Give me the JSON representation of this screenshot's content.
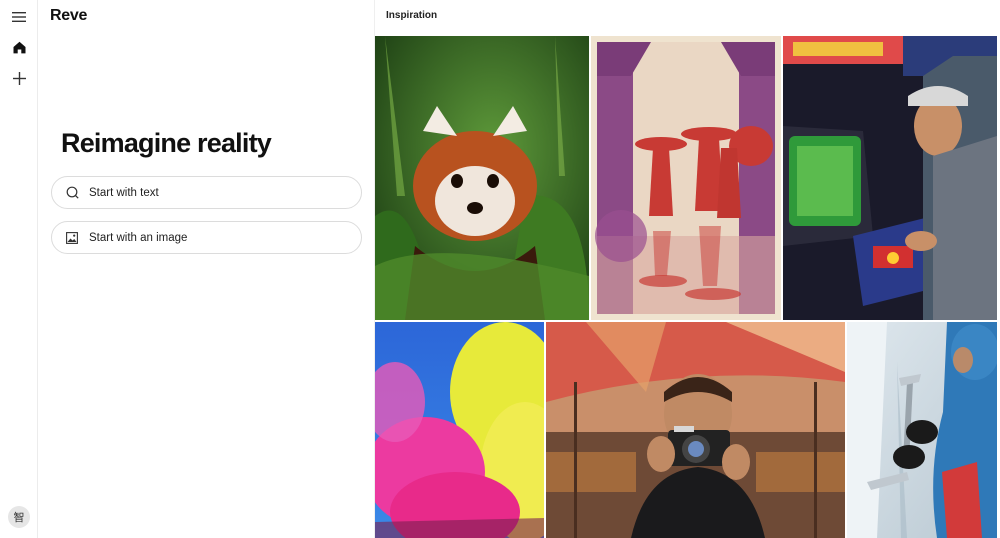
{
  "brand": "Reve",
  "hero": {
    "headline": "Reimagine reality",
    "start_text_label": "Start with text",
    "start_image_label": "Start with an image"
  },
  "inspiration": {
    "title": "Inspiration",
    "images": [
      {
        "subject": "red-panda"
      },
      {
        "subject": "umbrella-woodblock-print"
      },
      {
        "subject": "arcade-gamer"
      },
      {
        "subject": "color-smoke"
      },
      {
        "subject": "market-photographer"
      },
      {
        "subject": "ice-climber"
      }
    ]
  },
  "user": {
    "avatar_text": "智"
  },
  "icons": {
    "menu": "menu-icon",
    "home": "home-icon",
    "new": "plus-icon",
    "text": "search-icon",
    "image": "image-icon"
  }
}
